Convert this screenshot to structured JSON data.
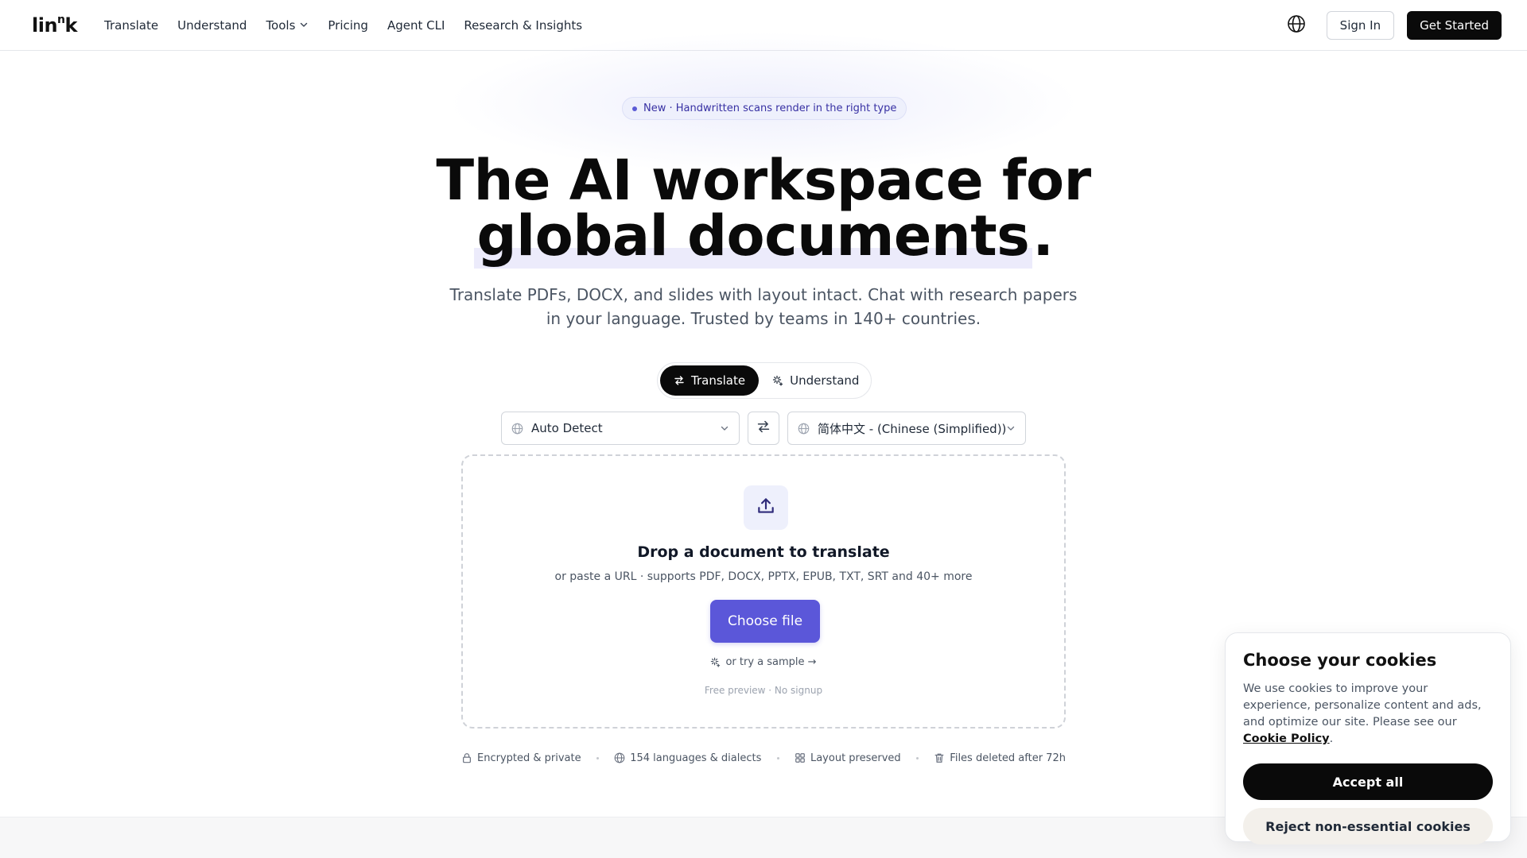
{
  "nav": {
    "logo_main": "lin",
    "logo_sup": "n",
    "logo_end": "k",
    "links": [
      "Translate",
      "Understand",
      "Tools",
      "Pricing",
      "Agent CLI",
      "Research & Insights"
    ],
    "signin_label": "Sign In",
    "getstarted_label": "Get Started",
    "icons": {
      "language": "globe-icon",
      "dropdown": "chevron-down-icon"
    }
  },
  "hero": {
    "badge": "New · Handwritten scans render in the right type",
    "title_line1": "The AI workspace for",
    "title_highlight": "global documents",
    "title_period": ".",
    "subtitle": "Translate PDFs, DOCX, and slides with layout intact. Chat with research papers in your language. Trusted by teams in 140+ countries."
  },
  "modes": {
    "translate_label": "Translate",
    "understand_label": "Understand",
    "active": "Translate"
  },
  "languages": {
    "source": "Auto Detect",
    "target": "简体中文 - (Chinese (Simplified))"
  },
  "dropzone": {
    "title": "Drop a document to translate",
    "subtitle": "or paste a URL · supports PDF, DOCX, PPTX, EPUB, TXT, SRT and 40+ more",
    "button_label": "Choose file",
    "sample_label": "or try a sample →",
    "note": "Free preview · No signup"
  },
  "features": [
    {
      "icon": "lock-icon",
      "label": "Encrypted & private"
    },
    {
      "icon": "globe-icon",
      "label": "154 languages & dialects"
    },
    {
      "icon": "grid-icon",
      "label": "Layout preserved"
    },
    {
      "icon": "trash-icon",
      "label": "Files deleted after 72h"
    }
  ],
  "cookie": {
    "title": "Choose your cookies",
    "text_before": "We use cookies to improve your experience, personalize content and ads, and optimize our site. Please see our ",
    "link_label": "Cookie Policy",
    "text_after": ".",
    "accept_label": "Accept all",
    "reject_label": "Reject non-essential cookies"
  },
  "colors": {
    "accent": "#5b57d9",
    "primary_dark": "#0a0a0a",
    "badge_bg": "#eef0fc"
  }
}
